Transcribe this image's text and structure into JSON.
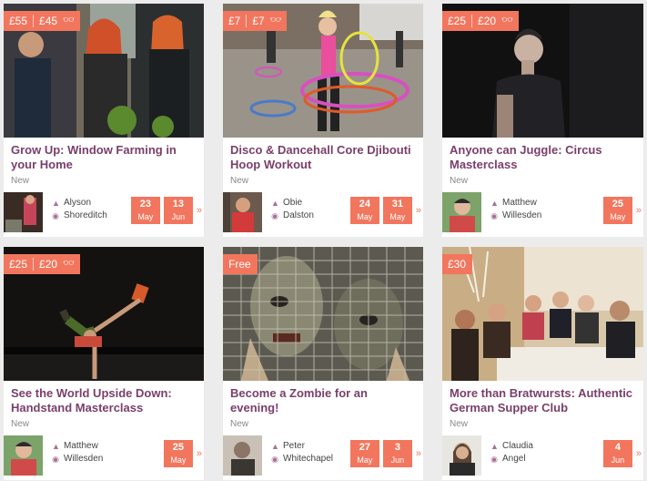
{
  "cards": [
    {
      "price": [
        "£55",
        "£45"
      ],
      "title": "Grow Up: Window Farming in your Home",
      "status": "New",
      "host": "Alyson",
      "location": "Shoreditch",
      "dates": [
        {
          "day": "23",
          "month": "May"
        },
        {
          "day": "13",
          "month": "Jun"
        }
      ],
      "image_icon": "gardening-photo",
      "avatar_icon": "host-avatar"
    },
    {
      "price": [
        "£7",
        "£7"
      ],
      "title": "Disco & Dancehall Core Djibouti Hoop Workout",
      "status": "New",
      "host": "Obie",
      "location": "Dalston",
      "dates": [
        {
          "day": "24",
          "month": "May"
        },
        {
          "day": "31",
          "month": "May"
        }
      ],
      "image_icon": "hula-hoop-photo",
      "avatar_icon": "host-avatar"
    },
    {
      "price": [
        "£25",
        "£20"
      ],
      "title": "Anyone can Juggle: Circus Masterclass",
      "status": "New",
      "host": "Matthew",
      "location": "Willesden",
      "dates": [
        {
          "day": "25",
          "month": "May"
        }
      ],
      "image_icon": "juggler-photo",
      "avatar_icon": "host-avatar"
    },
    {
      "price": [
        "£25",
        "£20"
      ],
      "title": "See the World Upside Down: Handstand Masterclass",
      "status": "New",
      "host": "Matthew",
      "location": "Willesden",
      "dates": [
        {
          "day": "25",
          "month": "May"
        }
      ],
      "image_icon": "handstand-photo",
      "avatar_icon": "host-avatar"
    },
    {
      "price": [
        "Free"
      ],
      "title": "Become a Zombie for an evening!",
      "status": "New",
      "host": "Peter",
      "location": "Whitechapel",
      "dates": [
        {
          "day": "27",
          "month": "May"
        },
        {
          "day": "3",
          "month": "Jun"
        }
      ],
      "image_icon": "zombie-photo",
      "avatar_icon": "host-avatar"
    },
    {
      "price": [
        "£30"
      ],
      "title": "More than Bratwursts: Authentic German Supper Club",
      "status": "New",
      "host": "Claudia",
      "location": "Angel",
      "dates": [
        {
          "day": "4",
          "month": "Jun"
        }
      ],
      "image_icon": "supper-club-photo",
      "avatar_icon": "host-avatar"
    }
  ],
  "icons": {
    "person": "person-icon",
    "location": "location-pin-icon",
    "glasses": "glasses-icon",
    "arrow": "chevron-right-icon"
  },
  "colors": {
    "accent": "#f2765e",
    "title": "#7a3e6a",
    "meta_icon": "#a86f96"
  }
}
